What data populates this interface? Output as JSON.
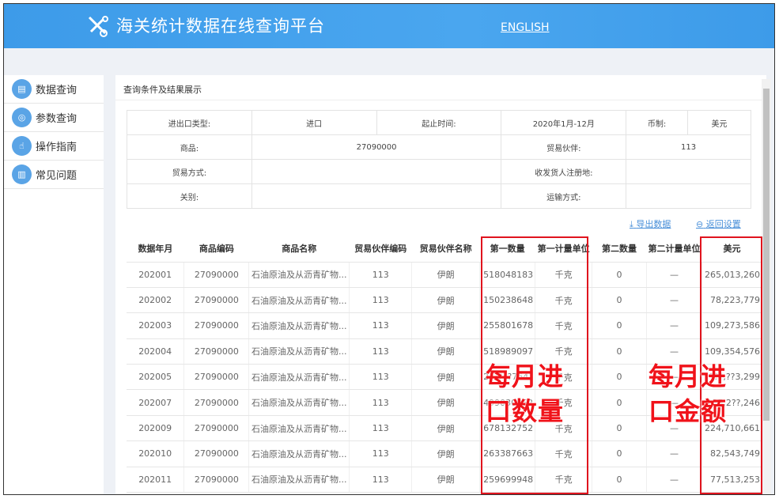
{
  "header": {
    "title": "海关统计数据在线查询平台",
    "english_link": "ENGLISH"
  },
  "sidebar": {
    "items": [
      {
        "label": "数据查询",
        "icon": "doc-search-icon"
      },
      {
        "label": "参数查询",
        "icon": "magnifier-icon"
      },
      {
        "label": "操作指南",
        "icon": "hand-icon"
      },
      {
        "label": "常见问题",
        "icon": "list-icon"
      }
    ]
  },
  "panel_title": "查询条件及结果展示",
  "filters": {
    "ie_type_label": "进出口类型:",
    "ie_type": "进口",
    "period_label": "起止时间:",
    "period": "2020年1月-12月",
    "currency_label": "币制:",
    "currency": "美元",
    "goods_label": "商品:",
    "goods": "27090000",
    "partner_label": "贸易伙伴:",
    "partner": "113",
    "trade_mode_label": "贸易方式:",
    "trade_mode": "",
    "consignee_label": "收发货人注册地:",
    "consignee": "",
    "customs_label": "关别:",
    "customs": "",
    "transport_label": "运输方式:",
    "transport": ""
  },
  "actions": {
    "export": "导出数据",
    "back": "返回设置"
  },
  "table": {
    "headers": [
      "数据年月",
      "商品编码",
      "商品名称",
      "贸易伙伴编码",
      "贸易伙伴名称",
      "第一数量",
      "第一计量单位",
      "第二数量",
      "第二计量单位",
      "美元"
    ],
    "rows": [
      [
        "202001",
        "27090000",
        "石油原油及从沥青矿物...",
        "113",
        "伊朗",
        "518048183",
        "千克",
        "0",
        "—",
        "265,013,260"
      ],
      [
        "202002",
        "27090000",
        "石油原油及从沥青矿物...",
        "113",
        "伊朗",
        "150238648",
        "千克",
        "0",
        "—",
        "78,223,779"
      ],
      [
        "202003",
        "27090000",
        "石油原油及从沥青矿物...",
        "113",
        "伊朗",
        "255801678",
        "千克",
        "0",
        "—",
        "109,273,586"
      ],
      [
        "202004",
        "27090000",
        "石油原油及从沥青矿物...",
        "113",
        "伊朗",
        "518989097",
        "千克",
        "0",
        "—",
        "109,354,576"
      ],
      [
        "202005",
        "27090000",
        "石油原油及从沥青矿物...",
        "113",
        "伊朗",
        "2?????764?",
        "千克",
        "0",
        "—",
        "???,??3,299"
      ],
      [
        "202007",
        "27090000",
        "石油原油及从沥青矿物...",
        "113",
        "伊朗",
        "499030852",
        "千克",
        "0",
        "—",
        "135,2??,246"
      ],
      [
        "202009",
        "27090000",
        "石油原油及从沥青矿物...",
        "113",
        "伊朗",
        "678132752",
        "千克",
        "0",
        "—",
        "224,710,661"
      ],
      [
        "202010",
        "27090000",
        "石油原油及从沥青矿物...",
        "113",
        "伊朗",
        "263387663",
        "千克",
        "0",
        "—",
        "82,543,749"
      ],
      [
        "202011",
        "27090000",
        "石油原油及从沥青矿物...",
        "113",
        "伊朗",
        "259699948",
        "千克",
        "0",
        "—",
        "77,513,253"
      ]
    ]
  },
  "annotations": {
    "quantity_line1": "每月进",
    "quantity_line2": "口数量",
    "amount_line1": "每月进",
    "amount_line2": "口金额",
    "color": "#f0121a"
  }
}
